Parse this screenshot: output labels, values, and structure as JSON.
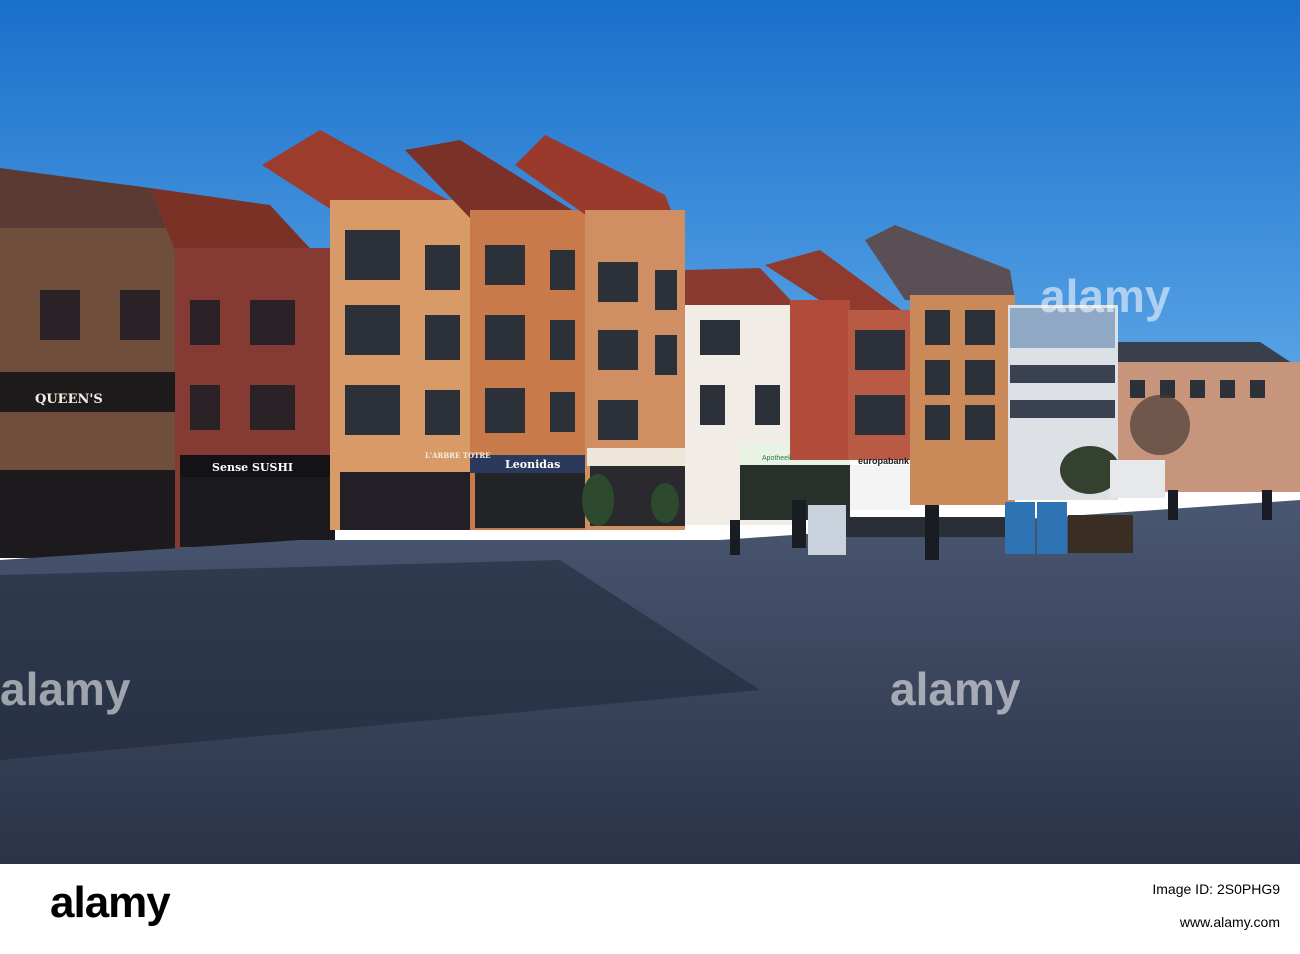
{
  "image": {
    "description_colors": {
      "sky_top": "#1f74cf",
      "sky_bottom": "#5aa6e6",
      "pavement": "#3d4a63",
      "shadow": "#2a3448",
      "brick_orange": "#c97a4a",
      "brick_red": "#a54a36",
      "roof": "#a3402f"
    }
  },
  "signs": {
    "queens": "QUEEN'S",
    "sushi": "Sense SUSHI",
    "leonidas": "Leonidas",
    "europabank": "europabank",
    "apotheek": "Apotheek",
    "arbre": "L'ARBRE TOTRE"
  },
  "watermark": {
    "text": "alamy"
  },
  "footer": {
    "logo": "alamy",
    "image_id_label": "Image ID: 2S0PHG9",
    "url": "www.alamy.com"
  }
}
